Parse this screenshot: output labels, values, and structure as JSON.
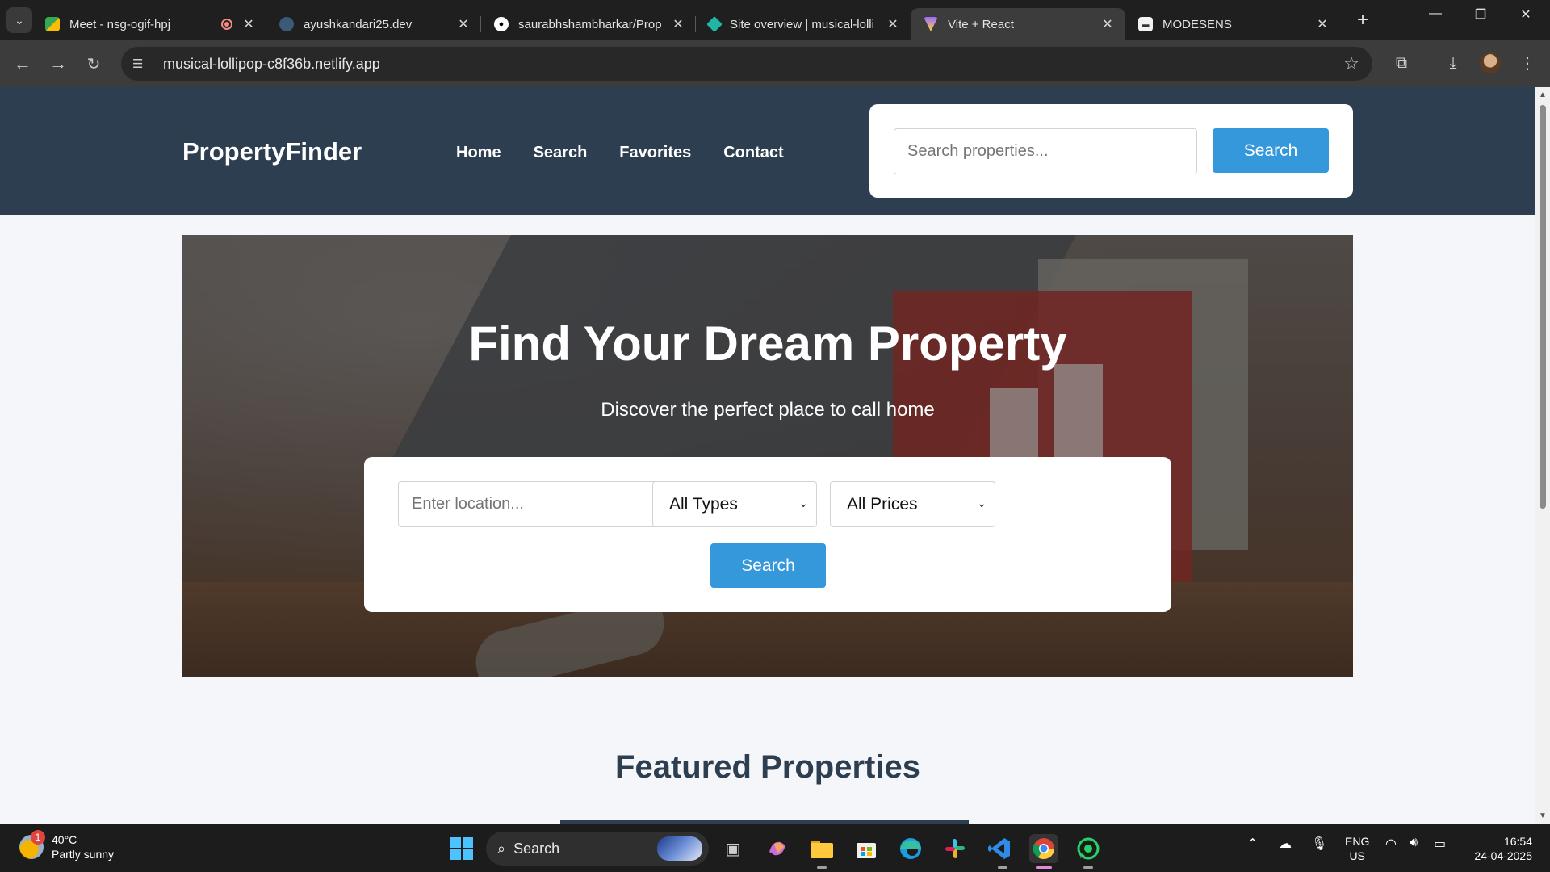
{
  "browser": {
    "tabs": [
      {
        "title": "Meet - nsg-ogif-hpj",
        "icon": "google-meet-icon"
      },
      {
        "title": "ayushkandari25.dev",
        "icon": "site-globe-icon"
      },
      {
        "title": "saurabhshambharkar/Prop",
        "icon": "github-icon"
      },
      {
        "title": "Site overview | musical-lolli",
        "icon": "netlify-icon"
      },
      {
        "title": "Vite + React",
        "icon": "vite-icon"
      },
      {
        "title": "MODESENS",
        "icon": "modesens-icon"
      }
    ],
    "url": "musical-lollipop-c8f36b.netlify.app"
  },
  "site": {
    "logo": "PropertyFinder",
    "nav": [
      "Home",
      "Search",
      "Favorites",
      "Contact"
    ],
    "header_search": {
      "placeholder": "Search properties...",
      "button": "Search"
    },
    "colors": {
      "header": "#2c3e50",
      "accent": "#3498db"
    }
  },
  "hero": {
    "title": "Find Your Dream Property",
    "subtitle": "Discover the perfect place to call home",
    "location_placeholder": "Enter location...",
    "type_selected": "All Types",
    "price_selected": "All Prices",
    "button": "Search"
  },
  "featured": {
    "title": "Featured Properties"
  },
  "taskbar": {
    "weather_temp": "40°C",
    "weather_desc": "Partly sunny",
    "weather_badge": "1",
    "search_label": "Search",
    "lang_1": "ENG",
    "lang_2": "US",
    "time": "16:54",
    "date": "24-04-2025"
  }
}
